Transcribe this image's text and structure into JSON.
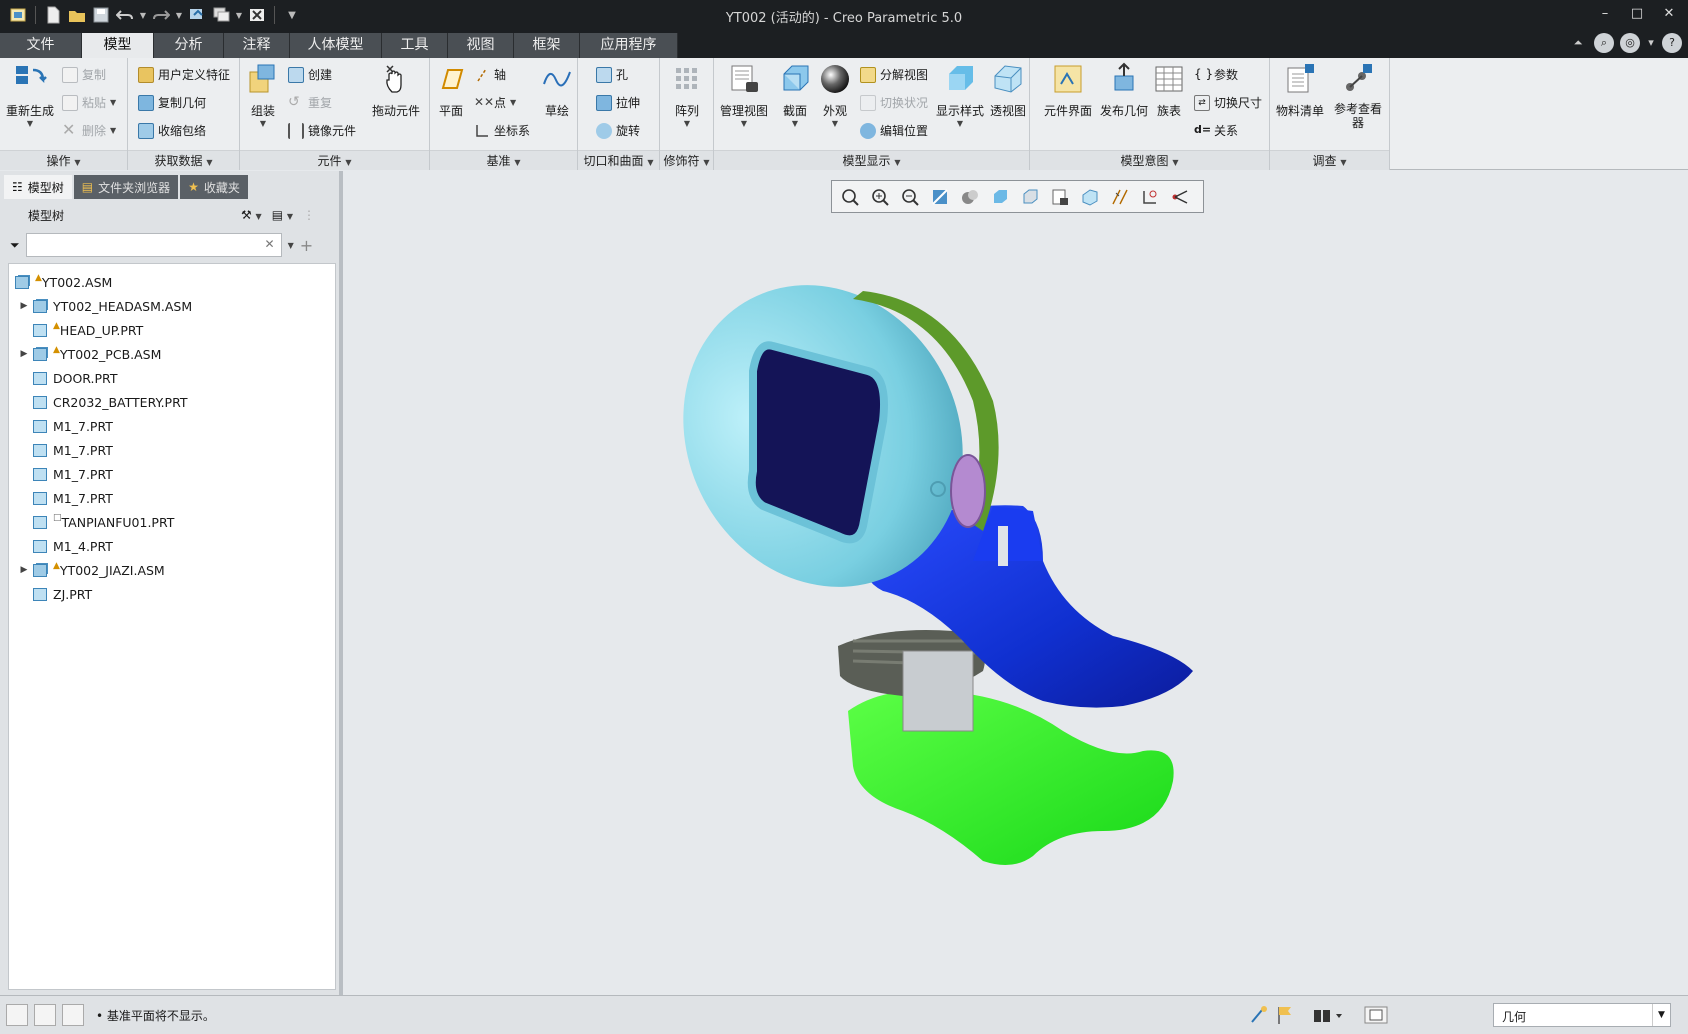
{
  "window": {
    "title": "YT002 (活动的) - Creo Parametric 5.0",
    "minimize": "–",
    "maximize": "□",
    "close": "✕"
  },
  "tabs": [
    {
      "label": "文件",
      "active": false
    },
    {
      "label": "模型",
      "active": true
    },
    {
      "label": "分析",
      "active": false
    },
    {
      "label": "注释",
      "active": false
    },
    {
      "label": "人体模型",
      "active": false
    },
    {
      "label": "工具",
      "active": false
    },
    {
      "label": "视图",
      "active": false
    },
    {
      "label": "框架",
      "active": false
    },
    {
      "label": "应用程序",
      "active": false
    }
  ],
  "ribbon": {
    "operations": {
      "label": "操作",
      "regenerate": "重新生成",
      "copy": "复制",
      "paste": "粘贴",
      "delete": "删除"
    },
    "get_data": {
      "label": "获取数据",
      "udf": "用户定义特征",
      "copy_geom": "复制几何",
      "shrinkwrap": "收缩包络"
    },
    "component": {
      "label": "元件",
      "assemble": "组装",
      "create": "创建",
      "repeat": "重复",
      "mirror": "镜像元件",
      "drag": "拖动元件"
    },
    "datum": {
      "label": "基准",
      "plane": "平面",
      "axis": "轴",
      "point": "点",
      "csys": "坐标系",
      "sketch": "草绘"
    },
    "cut_surface": {
      "label": "切口和曲面",
      "hole": "孔",
      "extrude": "拉伸",
      "revolve": "旋转"
    },
    "modifiers": {
      "label": "修饰符",
      "pattern": "阵列"
    },
    "model_display": {
      "label": "模型显示",
      "manage_views": "管理视图",
      "section": "截面",
      "appearance": "外观",
      "explode": "分解视图",
      "toggle_status": "切换状况",
      "edit_position": "编辑位置",
      "display_style": "显示样式",
      "perspective": "透视图"
    },
    "model_intent": {
      "label": "模型意图",
      "comp_interface": "元件界面",
      "publish_geom": "发布几何",
      "family_table": "族表",
      "params": "参数",
      "switch_dims": "切换尺寸",
      "relations": "关系"
    },
    "investigate": {
      "label": "调查",
      "bom": "物料清单",
      "ref_viewer": "参考查看器"
    }
  },
  "left_panel": {
    "tabs": [
      {
        "label": "模型树",
        "active": true
      },
      {
        "label": "文件夹浏览器",
        "active": false
      },
      {
        "label": "收藏夹",
        "active": false
      }
    ],
    "header": "模型树",
    "search_value": "",
    "tree": [
      {
        "label": "YT002.ASM",
        "type": "asm",
        "expand": "",
        "flag": "▲",
        "indent": 0
      },
      {
        "label": "YT002_HEADASM.ASM",
        "type": "asm",
        "expand": "▶",
        "flag": "",
        "indent": 1
      },
      {
        "label": "HEAD_UP.PRT",
        "type": "prt",
        "expand": "",
        "flag": "▲",
        "indent": 1
      },
      {
        "label": "YT002_PCB.ASM",
        "type": "asm",
        "expand": "▶",
        "flag": "▲",
        "indent": 1
      },
      {
        "label": "DOOR.PRT",
        "type": "prt",
        "expand": "",
        "flag": "",
        "indent": 1
      },
      {
        "label": "CR2032_BATTERY.PRT",
        "type": "prt",
        "expand": "",
        "flag": "",
        "indent": 1
      },
      {
        "label": "M1_7.PRT",
        "type": "prt",
        "expand": "",
        "flag": "",
        "indent": 1
      },
      {
        "label": "M1_7.PRT",
        "type": "prt",
        "expand": "",
        "flag": "",
        "indent": 1
      },
      {
        "label": "M1_7.PRT",
        "type": "prt",
        "expand": "",
        "flag": "",
        "indent": 1
      },
      {
        "label": "M1_7.PRT",
        "type": "prt",
        "expand": "",
        "flag": "",
        "indent": 1
      },
      {
        "label": "TANPIANFU01.PRT",
        "type": "prt",
        "expand": "",
        "flag": "□",
        "indent": 1
      },
      {
        "label": "M1_4.PRT",
        "type": "prt",
        "expand": "",
        "flag": "",
        "indent": 1
      },
      {
        "label": "YT002_JIAZI.ASM",
        "type": "asm",
        "expand": "▶",
        "flag": "▲",
        "indent": 1
      },
      {
        "label": "ZJ.PRT",
        "type": "prt",
        "expand": "",
        "flag": "",
        "indent": 1
      }
    ]
  },
  "status": {
    "message": "• 基准平面将不显示。",
    "selection_filter": "几何"
  },
  "colors": {
    "head_shell": "#86d8e6",
    "screen": "#141457",
    "body": "#1228c4",
    "clip": "#1ef21e",
    "pad": "#5a5e56",
    "green_band": "#5d9a2a"
  }
}
